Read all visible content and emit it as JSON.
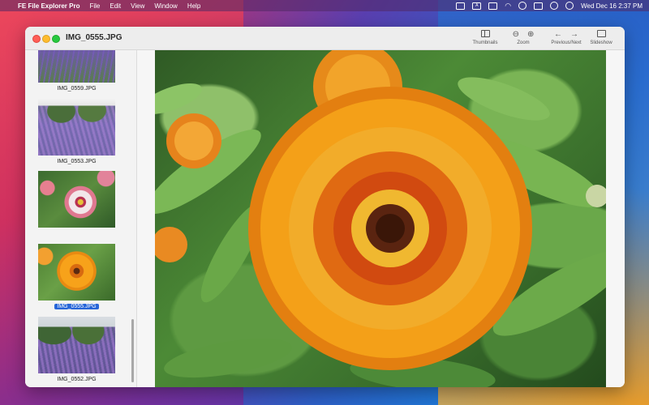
{
  "menubar": {
    "app_name": "FE File Explorer Pro",
    "menus": [
      "File",
      "Edit",
      "View",
      "Window",
      "Help"
    ],
    "status_icons": [
      "screen-mirroring-icon",
      "keyboard-input-icon",
      "battery-icon",
      "wifi-icon",
      "account-icon",
      "control-center-icon",
      "notification-icon",
      "siri-icon"
    ],
    "datetime": "Wed Dec 16  2:37 PM"
  },
  "window": {
    "title": "IMG_0555.JPG",
    "toolbar": {
      "thumbnails_label": "Thumbnails",
      "zoom_label": "Zoom",
      "prevnext_label": "Previous/Next",
      "slideshow_label": "Slideshow"
    }
  },
  "sidebar": {
    "items": [
      {
        "label": "IMG_0559.JPG",
        "selected": false
      },
      {
        "label": "IMG_0553.JPG",
        "selected": false
      },
      {
        "label": "",
        "selected": false
      },
      {
        "label": "IMG_0555.JPG",
        "selected": true
      },
      {
        "label": "IMG_0552.JPG",
        "selected": false
      }
    ]
  },
  "colors": {
    "selection": "#2866d8",
    "close": "#ff5f57",
    "minimize": "#febc2e",
    "maximize": "#28c840"
  }
}
